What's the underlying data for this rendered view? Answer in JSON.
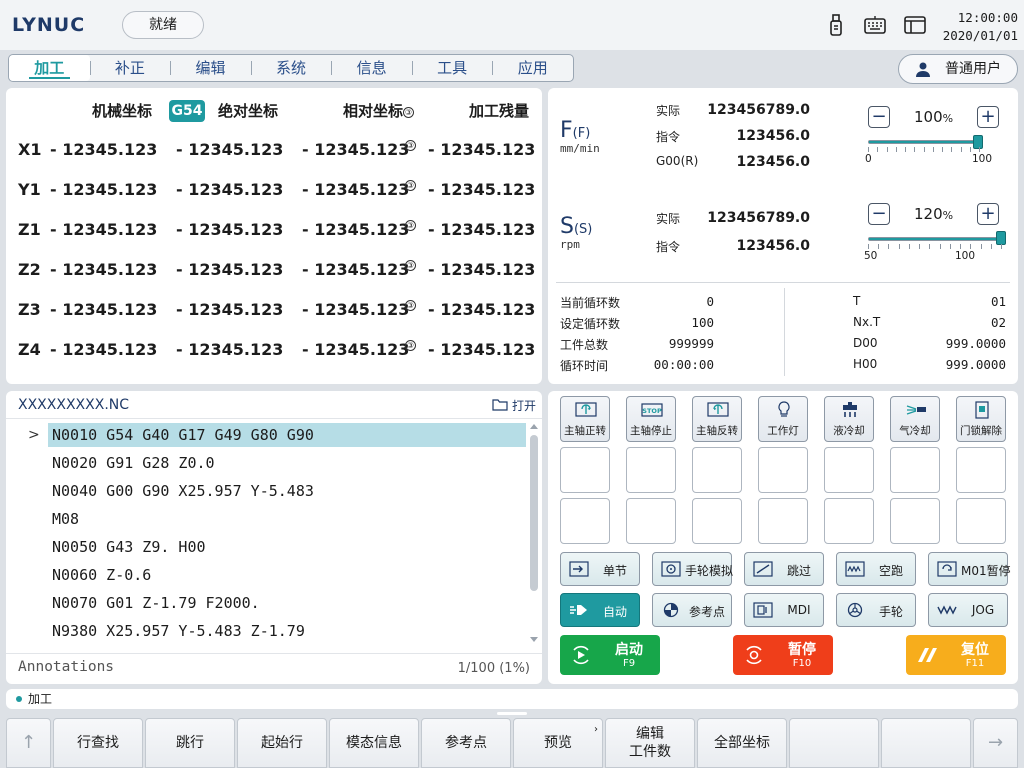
{
  "app": {
    "logo": "LYNUC",
    "status": "就绪",
    "time": "12:00:00",
    "date": "2020/01/01"
  },
  "nav": {
    "tabs": [
      "加工",
      "补正",
      "编辑",
      "系统",
      "信息",
      "工具",
      "应用"
    ],
    "active": 0
  },
  "user": {
    "label": "普通用户"
  },
  "coords": {
    "headers": {
      "machine": "机械坐标",
      "wcs": "G54",
      "absolute": "绝对坐标",
      "relative": "相对坐标",
      "remaining": "加工残量"
    },
    "circle_mark": "③",
    "rows": [
      {
        "axis": "X1",
        "machine": "- 12345.123",
        "absolute": "- 12345.123",
        "relative": "- 12345.123",
        "remaining": "- 12345.123"
      },
      {
        "axis": "Y1",
        "machine": "- 12345.123",
        "absolute": "- 12345.123",
        "relative": "- 12345.123",
        "remaining": "- 12345.123"
      },
      {
        "axis": "Z1",
        "machine": "- 12345.123",
        "absolute": "- 12345.123",
        "relative": "- 12345.123",
        "remaining": "- 12345.123"
      },
      {
        "axis": "Z2",
        "machine": "- 12345.123",
        "absolute": "- 12345.123",
        "relative": "- 12345.123",
        "remaining": "- 12345.123"
      },
      {
        "axis": "Z3",
        "machine": "- 12345.123",
        "absolute": "- 12345.123",
        "relative": "- 12345.123",
        "remaining": "- 12345.123"
      },
      {
        "axis": "Z4",
        "machine": "- 12345.123",
        "absolute": "- 12345.123",
        "relative": "- 12345.123",
        "remaining": "- 12345.123"
      }
    ]
  },
  "feed": {
    "letter": "F",
    "sub": "(F)",
    "unit": "mm/min",
    "rows": [
      {
        "label": "实际",
        "value": "123456789.0"
      },
      {
        "label": "指令",
        "value": "123456.0"
      },
      {
        "label": "G00(R)",
        "value": "123456.0"
      }
    ],
    "override": {
      "value": "100",
      "unit": "%",
      "fraction": 1.0,
      "min_label": "0",
      "max_label": "100"
    },
    "minus": "−",
    "plus": "+"
  },
  "spindle": {
    "letter": "S",
    "sub": "(S)",
    "unit": "rpm",
    "rows": [
      {
        "label": "实际",
        "value": "123456789.0"
      },
      {
        "label": "指令",
        "value": "123456.0"
      }
    ],
    "override": {
      "value": "120",
      "unit": "%",
      "min_label": "50",
      "max_label": "100"
    },
    "minus": "−",
    "plus": "+"
  },
  "cycle_info": {
    "left": [
      {
        "label": "当前循环数",
        "value": "0"
      },
      {
        "label": "设定循环数",
        "value": "100"
      },
      {
        "label": "工件总数",
        "value": "999999"
      },
      {
        "label": "循环时间",
        "value": "00:00:00"
      }
    ],
    "right": [
      {
        "label": "T",
        "value": "01"
      },
      {
        "label": "Nx.T",
        "value": "02"
      },
      {
        "label": "D00",
        "value": "999.0000"
      },
      {
        "label": "H00",
        "value": "999.0000"
      }
    ]
  },
  "program": {
    "filename": "XXXXXXXXX.NC",
    "open_label": "打开",
    "caret": ">",
    "lines": [
      "N0010 G54 G40 G17 G49 G80 G90",
      "N0020 G91 G28 Z0.0",
      "N0040 G00 G90 X25.957 Y-5.483",
      "M08",
      "N0050 G43 Z9. H00",
      "N0060 Z-0.6",
      "N0070 G01 Z-1.79 F2000.",
      "N9380 X25.957 Y-5.483 Z-1.79"
    ],
    "current_line": 0,
    "annotations": "Annotations",
    "count": "1/100 (1%)"
  },
  "function_buttons": [
    {
      "label": "主轴正转",
      "icon": "spindle-cw-icon"
    },
    {
      "label": "主轴停止",
      "icon": "spindle-stop-icon"
    },
    {
      "label": "主轴反转",
      "icon": "spindle-ccw-icon"
    },
    {
      "label": "工作灯",
      "icon": "work-light-icon"
    },
    {
      "label": "液冷却",
      "icon": "coolant-icon"
    },
    {
      "label": "气冷却",
      "icon": "air-cool-icon"
    },
    {
      "label": "门锁解除",
      "icon": "door-unlock-icon"
    }
  ],
  "function_icon_text": {
    "stop": "STOP"
  },
  "mode_buttons": [
    {
      "label": "单节",
      "icon": "single-block-icon",
      "active": false
    },
    {
      "label": "手轮模拟",
      "icon": "handwheel-sim-icon",
      "active": false
    },
    {
      "label": "跳过",
      "icon": "skip-icon",
      "active": false
    },
    {
      "label": "空跑",
      "icon": "dry-run-icon",
      "active": false
    },
    {
      "label": "M01暂停",
      "icon": "m01-pause-icon",
      "active": false
    },
    {
      "label": "自动",
      "icon": "auto-icon",
      "active": true
    },
    {
      "label": "参考点",
      "icon": "reference-point-icon",
      "active": false
    },
    {
      "label": "MDI",
      "icon": "mdi-icon",
      "active": false
    },
    {
      "label": "手轮",
      "icon": "handwheel-icon",
      "active": false
    },
    {
      "label": "JOG",
      "icon": "jog-icon",
      "active": false
    }
  ],
  "cycle_buttons": [
    {
      "label": "启动",
      "key": "F9",
      "color": "#17a64a"
    },
    {
      "label": "暂停",
      "key": "F10",
      "color": "#ef3e1a"
    },
    {
      "label": "复位",
      "key": "F11",
      "color": "#f7ad1c"
    }
  ],
  "message": {
    "text": "加工"
  },
  "softkeys": {
    "prev": "↑",
    "next": "→",
    "items": [
      "行查找",
      "跳行",
      "起始行",
      "模态信息",
      "参考点",
      "预览",
      "编辑\n工件数",
      "全部坐标",
      "",
      ""
    ],
    "more_mark": "›"
  }
}
